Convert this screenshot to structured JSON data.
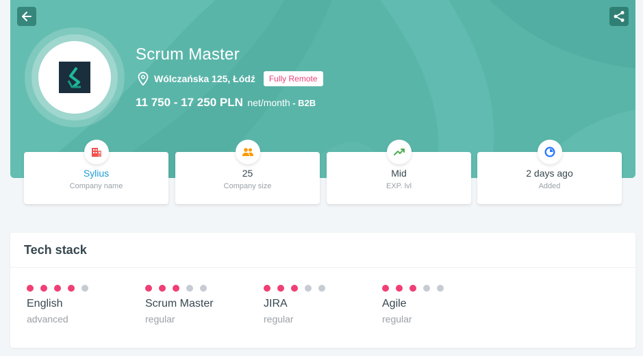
{
  "header": {
    "back_icon": "arrow-left-icon",
    "share_icon": "share-icon",
    "job_title": "Scrum Master",
    "location_icon": "map-pin-icon",
    "location": "Wólczańska 125, Łódź",
    "remote_badge": "Fully Remote",
    "salary_amount": "11 750 - 17 250 PLN",
    "salary_unit": "net/month",
    "salary_separator": " - ",
    "salary_type": "B2B",
    "accent_color": "#5ab5a9"
  },
  "info_cards": [
    {
      "icon": "building-icon",
      "icon_color": "#ef5350",
      "value": "Sylius",
      "label": "Company name"
    },
    {
      "icon": "people-icon",
      "icon_color": "#ff9800",
      "value": "25",
      "label": "Company size"
    },
    {
      "icon": "trending-up-icon",
      "icon_color": "#4caf50",
      "value": "Mid",
      "label": "EXP. lvl"
    },
    {
      "icon": "clock-icon",
      "icon_color": "#2979ff",
      "value": "2 days ago",
      "label": "Added"
    }
  ],
  "tech_stack": {
    "title": "Tech stack",
    "skills": [
      {
        "name": "English",
        "level": "advanced",
        "rating": 4,
        "max": 5
      },
      {
        "name": "Scrum Master",
        "level": "regular",
        "rating": 3,
        "max": 5
      },
      {
        "name": "JIRA",
        "level": "regular",
        "rating": 3,
        "max": 5
      },
      {
        "name": "Agile",
        "level": "regular",
        "rating": 3,
        "max": 5
      }
    ],
    "dot_on_color": "#ef3f74",
    "dot_off_color": "#c6cbd4"
  }
}
